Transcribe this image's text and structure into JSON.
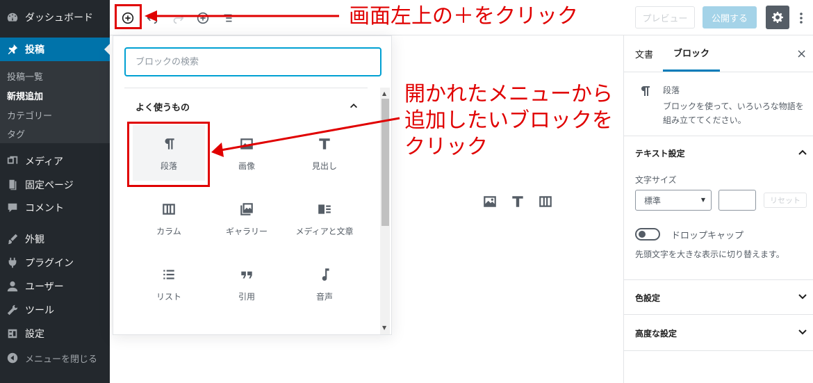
{
  "admin_menu": {
    "items": [
      {
        "label": "ダッシュボード",
        "icon": "dashboard-icon"
      },
      {
        "label": "投稿",
        "icon": "pin-icon"
      },
      {
        "label": "メディア",
        "icon": "media-icon"
      },
      {
        "label": "固定ページ",
        "icon": "page-icon"
      },
      {
        "label": "コメント",
        "icon": "comment-icon"
      },
      {
        "label": "外観",
        "icon": "brush-icon"
      },
      {
        "label": "プラグイン",
        "icon": "plugin-icon"
      },
      {
        "label": "ユーザー",
        "icon": "user-icon"
      },
      {
        "label": "ツール",
        "icon": "wrench-icon"
      },
      {
        "label": "設定",
        "icon": "settings-icon"
      }
    ],
    "submenu": [
      "投稿一覧",
      "新規追加",
      "カテゴリー",
      "タグ"
    ],
    "collapse_label": "メニューを閉じる"
  },
  "toolbar": {
    "preview_label": "プレビュー",
    "publish_label": "公開する"
  },
  "inserter": {
    "search_placeholder": "ブロックの検索",
    "panel_title": "よく使うもの",
    "blocks": [
      {
        "label": "段落",
        "icon": "paragraph-icon"
      },
      {
        "label": "画像",
        "icon": "image-icon"
      },
      {
        "label": "見出し",
        "icon": "heading-icon"
      },
      {
        "label": "カラム",
        "icon": "columns-icon"
      },
      {
        "label": "ギャラリー",
        "icon": "gallery-icon"
      },
      {
        "label": "メディアと文章",
        "icon": "media-text-icon"
      },
      {
        "label": "リスト",
        "icon": "list-icon"
      },
      {
        "label": "引用",
        "icon": "quote-icon"
      },
      {
        "label": "音声",
        "icon": "audio-icon"
      }
    ]
  },
  "sidebar": {
    "tab_document": "文書",
    "tab_block": "ブロック",
    "close": "×",
    "block_title": "段落",
    "block_description": "ブロックを使って、いろいろな物語を組み立ててください。",
    "text_settings_title": "テキスト設定",
    "font_size_label": "文字サイズ",
    "font_size_value": "標準",
    "reset_label": "リセット",
    "drop_cap_label": "ドロップキャップ",
    "drop_cap_help": "先頭文字を大きな表示に切り替えます。",
    "color_settings_title": "色設定",
    "advanced_title": "高度な設定"
  },
  "annotations": {
    "callout_top": "画面左上の＋をクリック",
    "callout_lines": [
      "開かれたメニューから",
      "追加したいブロックを",
      "クリック"
    ],
    "color": "#e00000"
  }
}
